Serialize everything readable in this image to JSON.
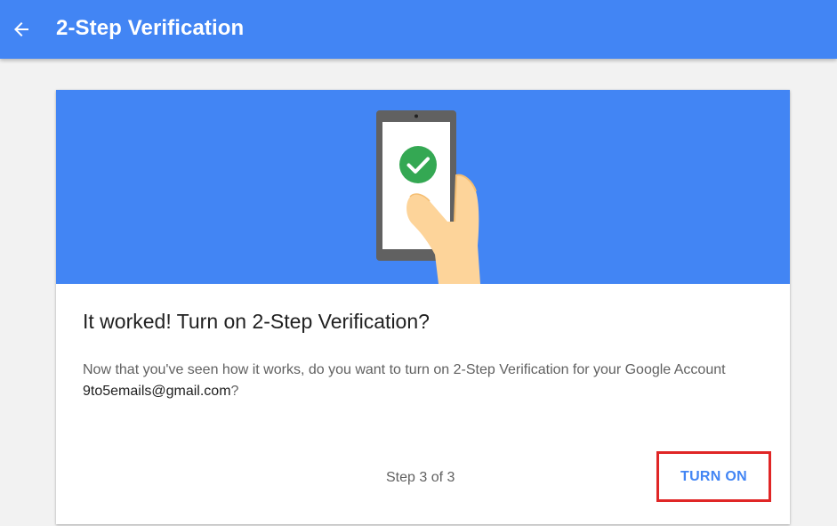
{
  "appbar": {
    "title": "2-Step Verification",
    "back_icon": "arrow-back-icon",
    "color": "#4285f4"
  },
  "hero": {
    "illustration": "phone-in-hand-with-checkmark",
    "check_icon": "check-circle-icon",
    "check_color": "#34a853"
  },
  "content": {
    "heading": "It worked! Turn on 2-Step Verification?",
    "body_prefix": "Now that you've seen how it works, do you want to turn on 2-Step Verification for your Google Account ",
    "email": "9to5emails@gmail.com",
    "body_suffix": "?"
  },
  "footer": {
    "step_text": "Step 3 of 3",
    "turn_on_label": "TURN ON",
    "highlight_color": "#e02626"
  }
}
